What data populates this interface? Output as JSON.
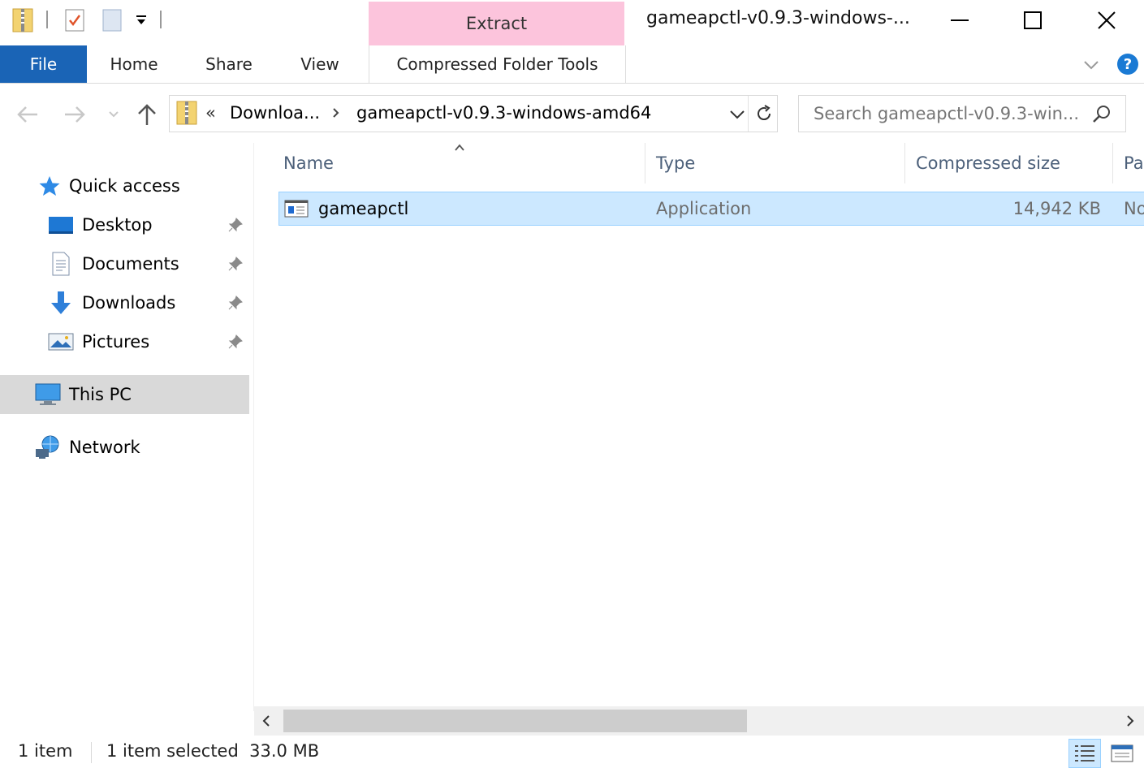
{
  "window": {
    "title": "gameapctl-v0.9.3-windows-...",
    "context_tab_group": "Extract",
    "minimize_label": "",
    "colors": {
      "accent_file_tab": "#1a64b6",
      "context_group": "#fcc4dc",
      "selection": "#cce8ff",
      "help": "#1a7ad4"
    }
  },
  "ribbon": {
    "tabs": [
      {
        "label": "File"
      },
      {
        "label": "Home"
      },
      {
        "label": "Share"
      },
      {
        "label": "View"
      },
      {
        "label": "Compressed Folder Tools"
      }
    ]
  },
  "address": {
    "overflow": "«",
    "segments": [
      "Downloa...",
      "gameapctl-v0.9.3-windows-amd64"
    ]
  },
  "search": {
    "placeholder": "Search gameapctl-v0.9.3-win..."
  },
  "navpane": {
    "quick_access": "Quick access",
    "pinned": [
      {
        "label": "Desktop",
        "icon": "desktop-icon"
      },
      {
        "label": "Documents",
        "icon": "documents-icon"
      },
      {
        "label": "Downloads",
        "icon": "downloads-icon"
      },
      {
        "label": "Pictures",
        "icon": "pictures-icon"
      }
    ],
    "this_pc": "This PC",
    "network": "Network"
  },
  "content": {
    "columns": [
      "Name",
      "Type",
      "Compressed size",
      "Pa"
    ],
    "rows": [
      {
        "name": "gameapctl",
        "type": "Application",
        "compressed_size": "14,942 KB",
        "password": "No"
      }
    ]
  },
  "status": {
    "item_count": "1 item",
    "selection": "1 item selected  33.0 MB"
  }
}
